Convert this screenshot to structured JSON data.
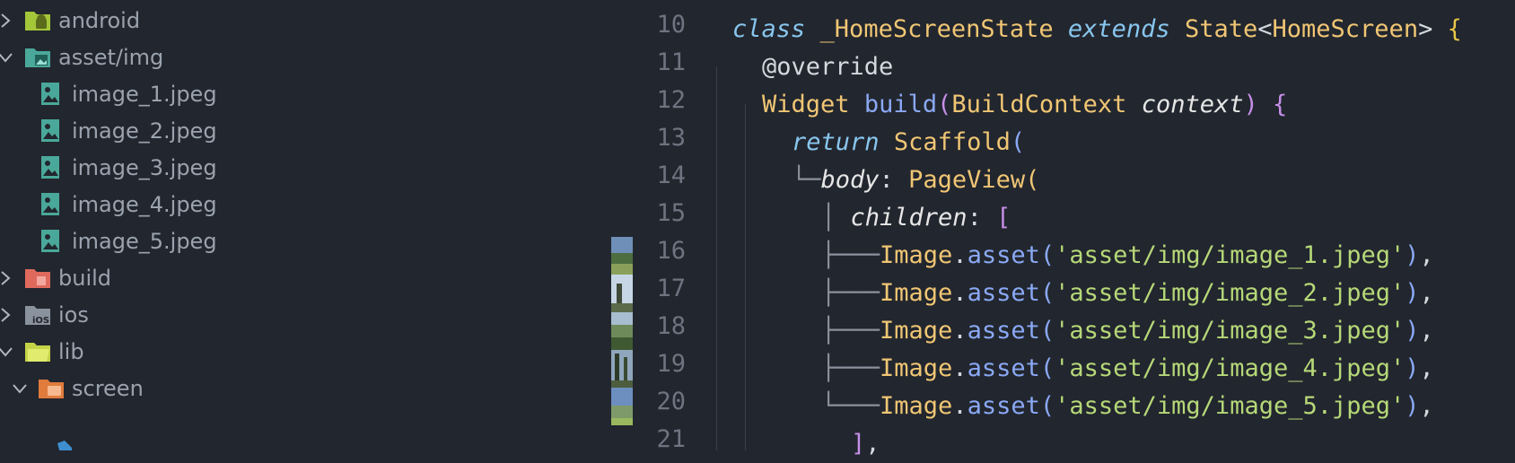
{
  "explorer": {
    "items": [
      {
        "label": "android",
        "icon": "android-folder-icon",
        "expanded": false,
        "indent": 0
      },
      {
        "label": "asset/img",
        "icon": "image-folder-icon",
        "expanded": true,
        "indent": 0
      },
      {
        "label": "image_1.jpeg",
        "icon": "image-file-icon",
        "indent": 1
      },
      {
        "label": "image_2.jpeg",
        "icon": "image-file-icon",
        "indent": 1
      },
      {
        "label": "image_3.jpeg",
        "icon": "image-file-icon",
        "indent": 1
      },
      {
        "label": "image_4.jpeg",
        "icon": "image-file-icon",
        "indent": 1
      },
      {
        "label": "image_5.jpeg",
        "icon": "image-file-icon",
        "indent": 1
      },
      {
        "label": "build",
        "icon": "build-folder-icon",
        "expanded": false,
        "indent": 0
      },
      {
        "label": "ios",
        "icon": "ios-folder-icon",
        "expanded": false,
        "indent": 0
      },
      {
        "label": "lib",
        "icon": "lib-folder-icon",
        "expanded": true,
        "indent": 0
      },
      {
        "label": "screen",
        "icon": "screen-folder-icon",
        "expanded": true,
        "indent": 1
      }
    ]
  },
  "editor": {
    "line_numbers": [
      "10",
      "11",
      "12",
      "13",
      "14",
      "15",
      "16",
      "17",
      "18",
      "19",
      "20",
      "21"
    ],
    "tokens": {
      "class_kw": "class",
      "state_class": "_HomeScreenState",
      "extends_kw": "extends",
      "state": "State",
      "lt": "<",
      "home_screen": "HomeScreen",
      "gt": ">",
      "open_brace": "{",
      "override": "@override",
      "widget": "Widget",
      "build": "build",
      "build_context": "BuildContext",
      "context": "context",
      "return_kw": "return",
      "scaffold": "Scaffold",
      "body": "body",
      "colon": ":",
      "page_view": "PageView",
      "children": "children",
      "open_bracket": "[",
      "image": "Image",
      "asset": "asset",
      "close_bracket": "]",
      "paths": [
        "'asset/img/image_1.jpeg'",
        "'asset/img/image_2.jpeg'",
        "'asset/img/image_3.jpeg'",
        "'asset/img/image_4.jpeg'",
        "'asset/img/image_5.jpeg'"
      ]
    }
  }
}
